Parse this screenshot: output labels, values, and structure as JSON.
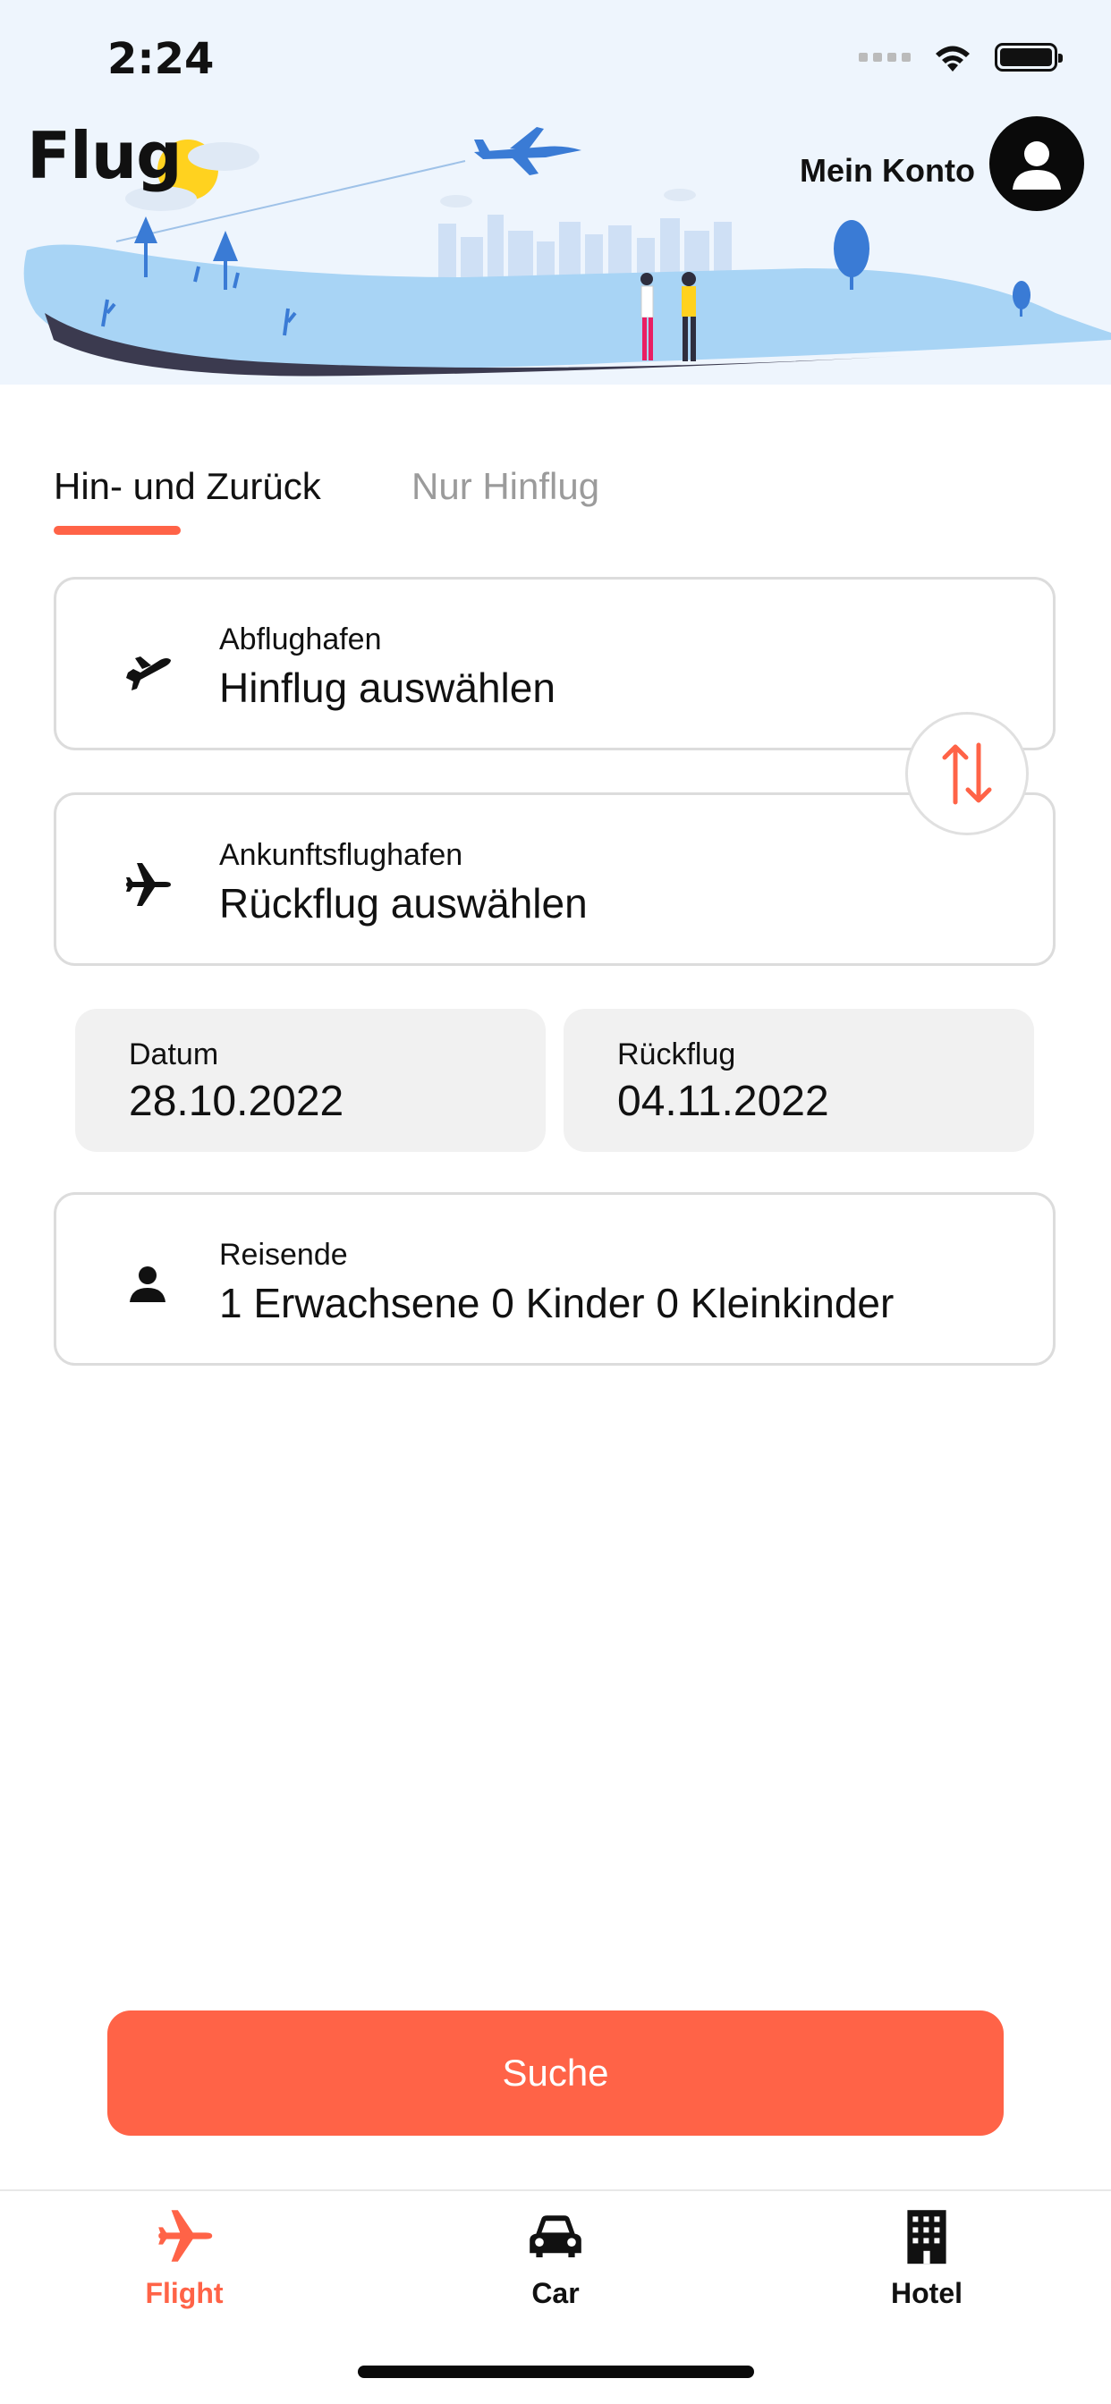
{
  "status_bar": {
    "time": "2:24"
  },
  "header": {
    "brand": "Flug",
    "account_label": "Mein Konto"
  },
  "tabs": [
    {
      "label": "Hin- und Zurück",
      "active": true
    },
    {
      "label": "Nur Hinflug",
      "active": false
    }
  ],
  "departure": {
    "label": "Abflughafen",
    "value": "Hinflug auswählen",
    "icon": "plane-takeoff-icon"
  },
  "arrival": {
    "label": "Ankunftsflughafen",
    "value": "Rückflug auswählen",
    "icon": "plane-icon"
  },
  "dates": {
    "depart": {
      "label": "Datum",
      "value": "28.10.2022"
    },
    "return": {
      "label": "Rückflug",
      "value": "04.11.2022"
    }
  },
  "travelers": {
    "label": "Reisende",
    "value": "1 Erwachsene 0 Kinder 0 Kleinkinder",
    "icon": "person-icon"
  },
  "search_button": {
    "label": "Suche"
  },
  "bottom_nav": [
    {
      "label": "Flight",
      "icon": "plane-icon",
      "active": true
    },
    {
      "label": "Car",
      "icon": "car-icon",
      "active": false
    },
    {
      "label": "Hotel",
      "icon": "building-icon",
      "active": false
    }
  ],
  "colors": {
    "accent": "#ff6347",
    "header_bg": "#eef5fd",
    "hill": "#a8d4f5",
    "hill_dark": "#3b3a4f"
  }
}
